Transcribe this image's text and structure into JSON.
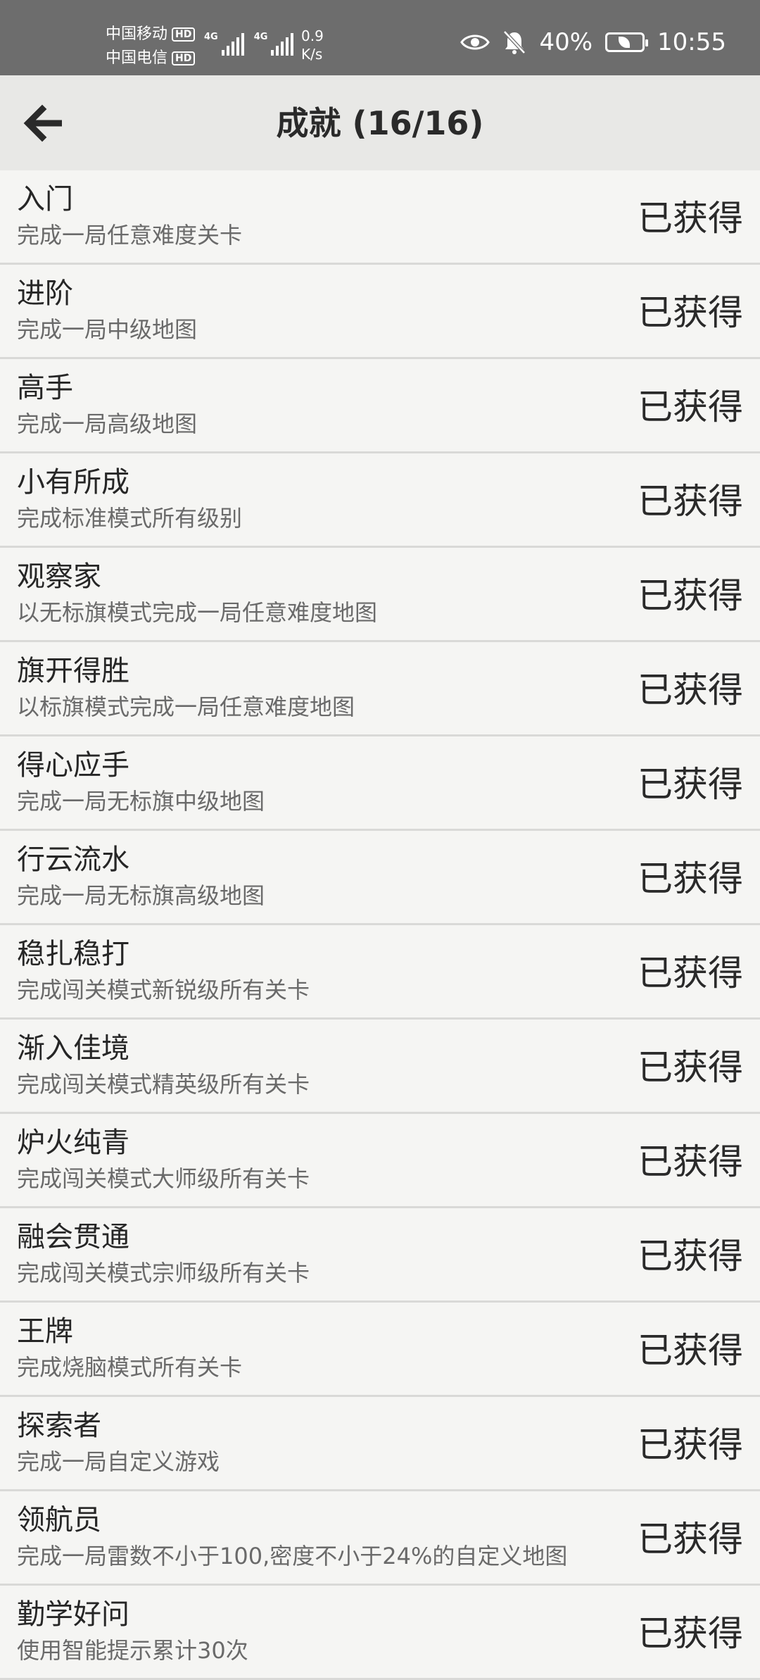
{
  "status_bar": {
    "carrier1": "中国移动",
    "carrier2": "中国电信",
    "hd": "HD",
    "net1": "4G",
    "net2": "4G",
    "speed_value": "0.9",
    "speed_unit": "K/s",
    "battery": "40%",
    "time": "10:55"
  },
  "header": {
    "title": "成就 (16/16)"
  },
  "achievements": [
    {
      "title": "入门",
      "desc": "完成一局任意难度关卡",
      "status": "已获得"
    },
    {
      "title": "进阶",
      "desc": "完成一局中级地图",
      "status": "已获得"
    },
    {
      "title": "高手",
      "desc": "完成一局高级地图",
      "status": "已获得"
    },
    {
      "title": "小有所成",
      "desc": "完成标准模式所有级别",
      "status": "已获得"
    },
    {
      "title": "观察家",
      "desc": "以无标旗模式完成一局任意难度地图",
      "status": "已获得"
    },
    {
      "title": "旗开得胜",
      "desc": "以标旗模式完成一局任意难度地图",
      "status": "已获得"
    },
    {
      "title": "得心应手",
      "desc": "完成一局无标旗中级地图",
      "status": "已获得"
    },
    {
      "title": "行云流水",
      "desc": "完成一局无标旗高级地图",
      "status": "已获得"
    },
    {
      "title": "稳扎稳打",
      "desc": "完成闯关模式新锐级所有关卡",
      "status": "已获得"
    },
    {
      "title": "渐入佳境",
      "desc": "完成闯关模式精英级所有关卡",
      "status": "已获得"
    },
    {
      "title": "炉火纯青",
      "desc": "完成闯关模式大师级所有关卡",
      "status": "已获得"
    },
    {
      "title": "融会贯通",
      "desc": "完成闯关模式宗师级所有关卡",
      "status": "已获得"
    },
    {
      "title": "王牌",
      "desc": "完成烧脑模式所有关卡",
      "status": "已获得"
    },
    {
      "title": "探索者",
      "desc": "完成一局自定义游戏",
      "status": "已获得"
    },
    {
      "title": "领航员",
      "desc": "完成一局雷数不小于100,密度不小于24%的自定义地图",
      "status": "已获得"
    },
    {
      "title": "勤学好问",
      "desc": "使用智能提示累计30次",
      "status": "已获得"
    }
  ]
}
